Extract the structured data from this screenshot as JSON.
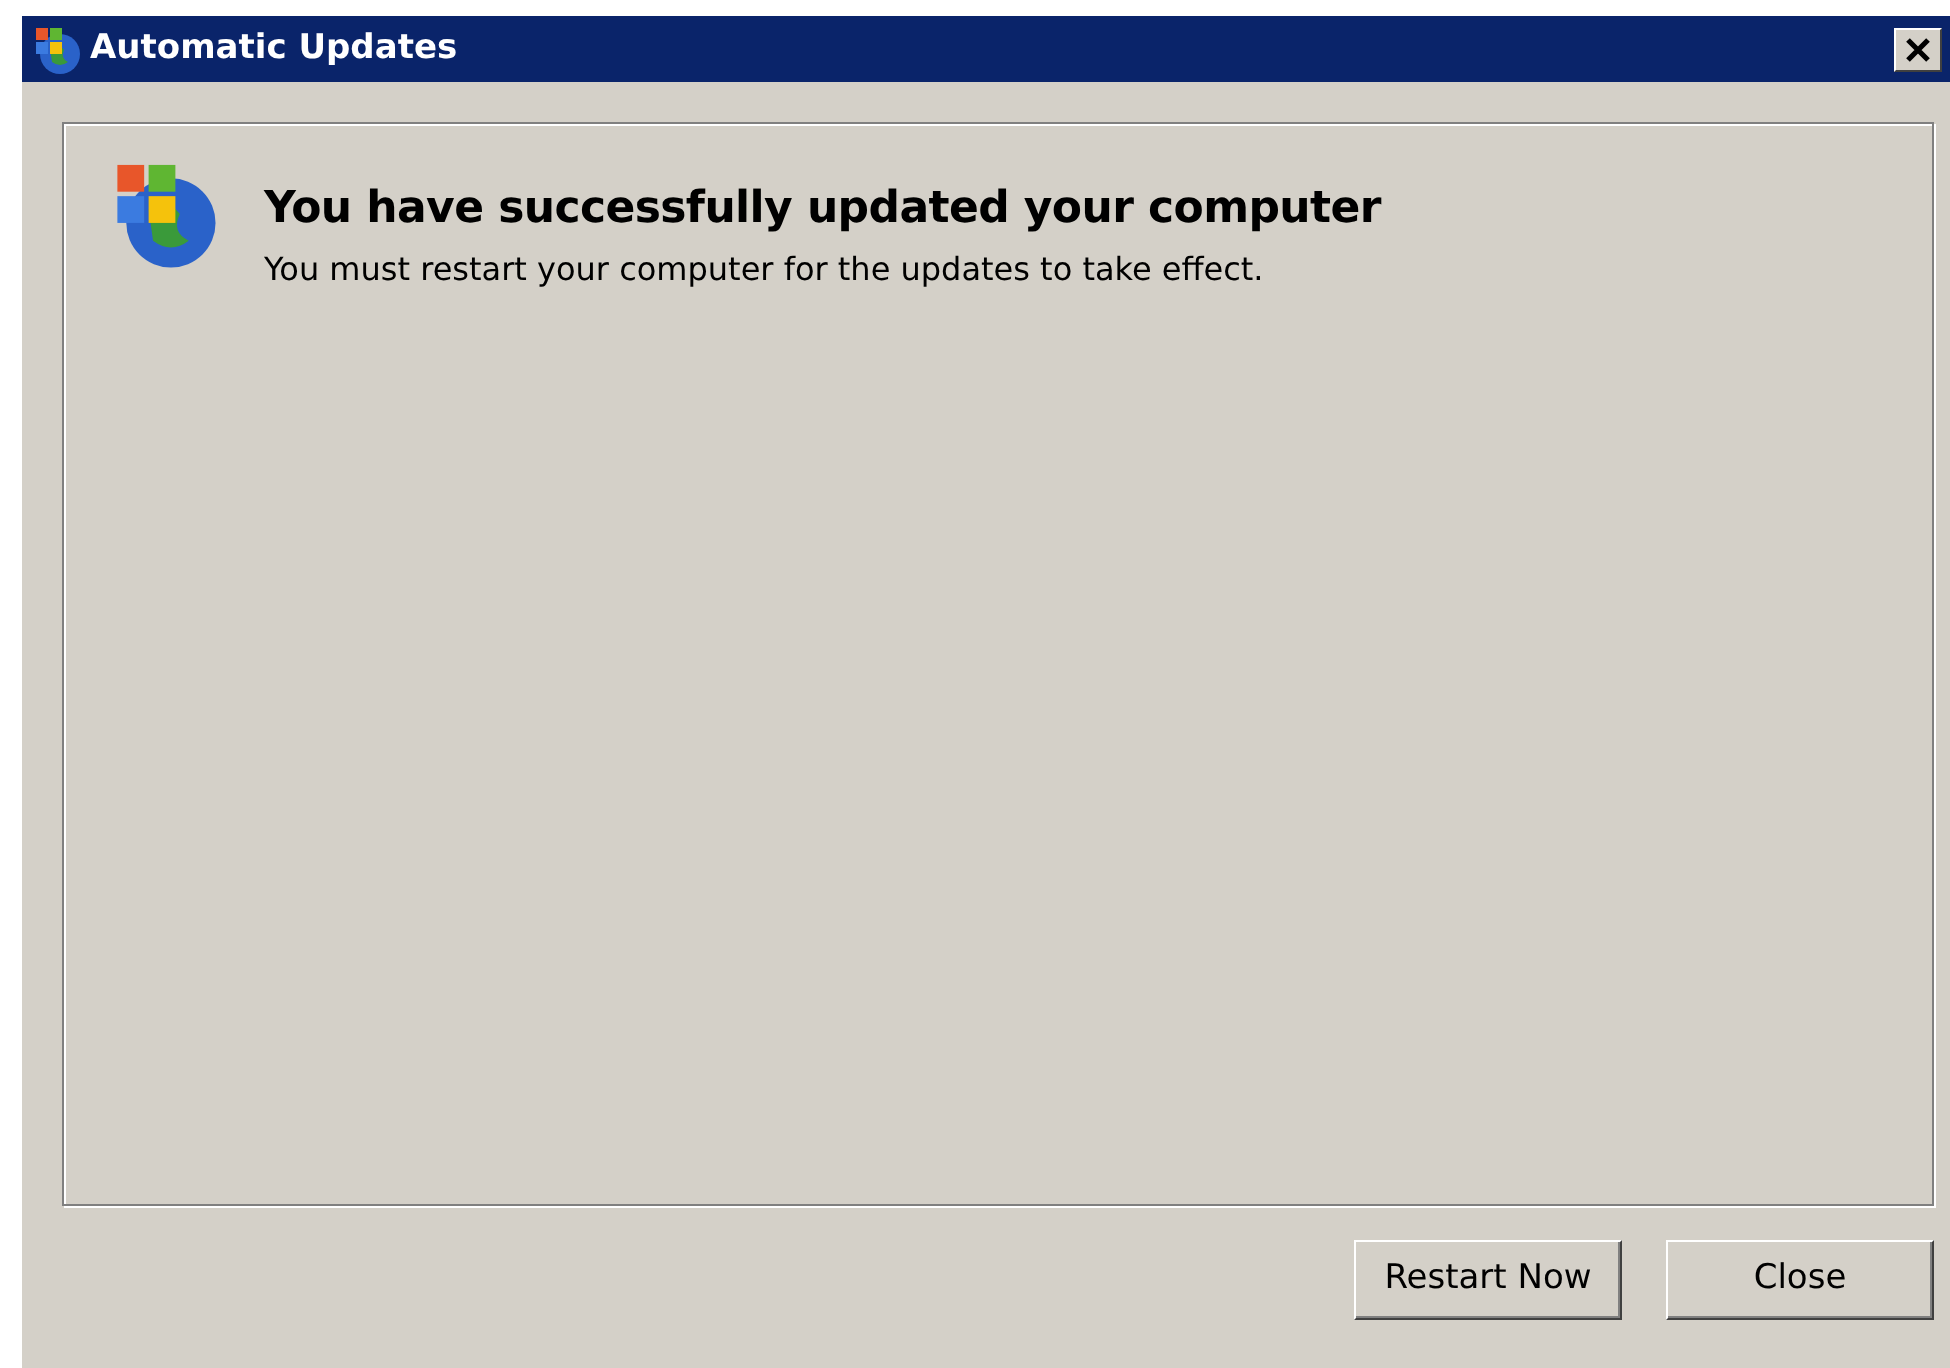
{
  "window": {
    "title": "Automatic Updates"
  },
  "message": {
    "heading": "You have successfully updated your computer",
    "text": "You must restart your computer for the updates to take effect."
  },
  "buttons": [
    {
      "label": "Restart Now"
    },
    {
      "label": "Close"
    }
  ]
}
